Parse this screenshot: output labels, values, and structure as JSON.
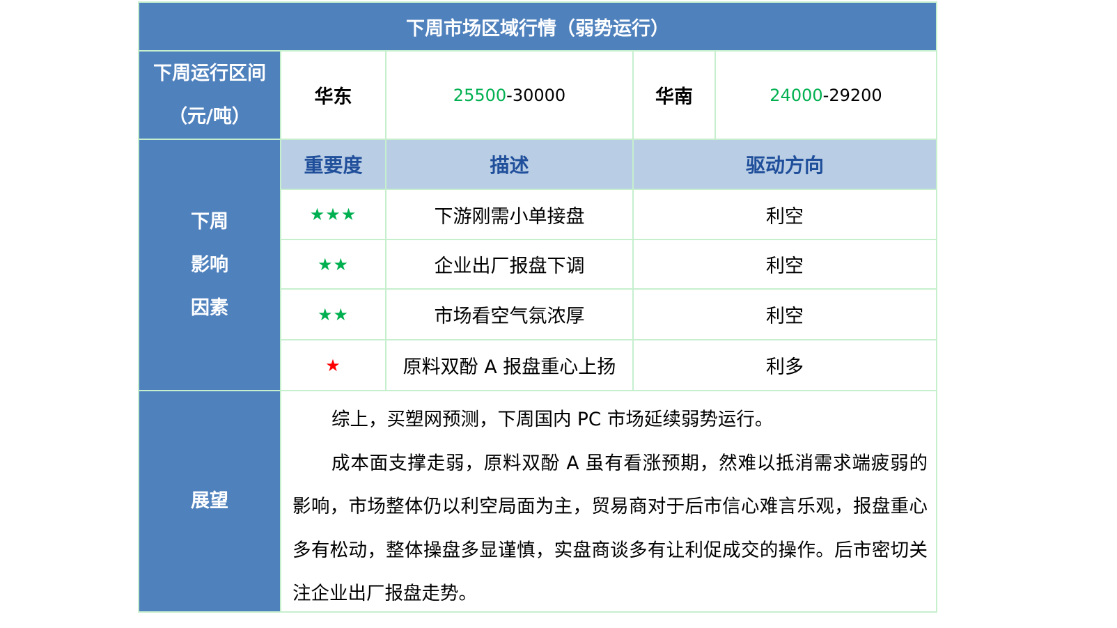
{
  "header": {
    "title": "下周市场区域行情（弱势运行）"
  },
  "range": {
    "label_line1": "下周运行区间",
    "label_line2": "（元/吨）",
    "regions": [
      {
        "name": "华东",
        "low": "25500",
        "high": "30000"
      },
      {
        "name": "华南",
        "low": "24000",
        "high": "29200"
      }
    ],
    "separator": "-"
  },
  "factors": {
    "label_lines": [
      "下周",
      "影响",
      "因素"
    ],
    "columns": [
      "重要度",
      "描述",
      "驱动方向"
    ],
    "rows": [
      {
        "stars": "★★★",
        "star_count": 3,
        "star_color": "#00b050",
        "description": "下游刚需小单接盘",
        "direction": "利空"
      },
      {
        "stars": "★★",
        "star_count": 2,
        "star_color": "#00b050",
        "description": "企业出厂报盘下调",
        "direction": "利空"
      },
      {
        "stars": "★★",
        "star_count": 2,
        "star_color": "#00b050",
        "description": "市场看空气氛浓厚",
        "direction": "利空"
      },
      {
        "stars": "★",
        "star_count": 1,
        "star_color": "#ff0000",
        "description": "原料双酚 A 报盘重心上扬",
        "direction": "利多"
      }
    ]
  },
  "outlook": {
    "label": "展望",
    "paragraph1": "综上，买塑网预测，下周国内 PC 市场延续弱势运行。",
    "paragraph2": "成本面支撑走弱，原料双酚 A 虽有看涨预期，然难以抵消需求端疲弱的影响，市场整体仍以利空局面为主，贸易商对于后市信心难言乐观，报盘重心多有松动，整体操盘多显谨慎，实盘商谈多有让利促成交的操作。后市密切关注企业出厂报盘走势。"
  },
  "colors": {
    "header_bg": "#4f81bd",
    "subheader_bg": "#b9cde5",
    "subheader_text": "#1f4e9a",
    "grid_lines": "#c6efce",
    "value_green": "#00b050",
    "star_red": "#ff0000"
  }
}
